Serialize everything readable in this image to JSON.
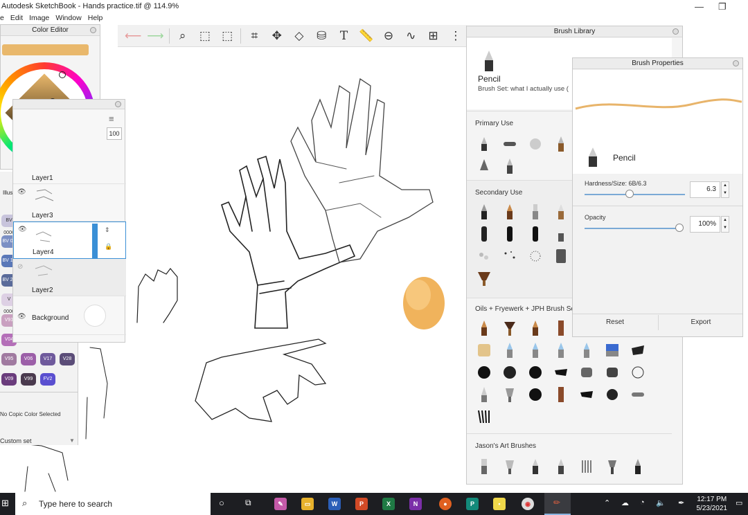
{
  "app": {
    "window_title": "Autodesk SketchBook - Hands practice.tif @ 114.9%",
    "menu": [
      "e",
      "Edit",
      "Image",
      "Window",
      "Help"
    ]
  },
  "color_editor": {
    "title": "Color Editor",
    "current_color": "#e9b86c"
  },
  "layers": {
    "opacity": "100",
    "items": [
      {
        "name": "Layer1",
        "visible": true
      },
      {
        "name": "Layer3",
        "visible": true
      },
      {
        "name": "Layer4",
        "visible": true,
        "active": true
      },
      {
        "name": "Layer2",
        "visible": false
      },
      {
        "name": "Background",
        "visible": true
      }
    ]
  },
  "copic": {
    "label_illus": "Illus",
    "chips": [
      {
        "code": "BV 0000",
        "color": "#c8c4dc"
      },
      {
        "code": "BV 01",
        "color": "#7b8fc4"
      },
      {
        "code": "BV 13",
        "color": "#5a78b8"
      },
      {
        "code": "BV 25",
        "color": "#5a6b9a"
      },
      {
        "code": "V 0000",
        "color": "#ddd0e4"
      },
      {
        "code": "V91",
        "color": "#c9a0c0"
      },
      {
        "code": "V04",
        "color": "#b46fb8"
      },
      {
        "code": "V95",
        "color": "#a07aa0"
      },
      {
        "code": "V06",
        "color": "#9c5fa8"
      },
      {
        "code": "V17",
        "color": "#6f5a9c"
      },
      {
        "code": "V28",
        "color": "#5b4d78"
      },
      {
        "code": "V09",
        "color": "#6a3c7c"
      },
      {
        "code": "V99",
        "color": "#4a3a4e"
      },
      {
        "code": "FV2",
        "color": "#5a4fd0"
      }
    ],
    "status": "No Copic Color Selected",
    "set": "Custom set"
  },
  "brush_library": {
    "title": "Brush Library",
    "current_brush": "Pencil",
    "brush_set": "Brush Set: what I actually use (",
    "sections": [
      "Primary Use",
      "Secondary Use",
      "Oils + Fryewerk + JPH Brush Set",
      "Jason's Art Brushes"
    ]
  },
  "brush_properties": {
    "title": "Brush Properties",
    "brush_name": "Pencil",
    "hardness_label": "Hardness/Size: 6B/6.3",
    "hardness_value": "6.3",
    "opacity_label": "Opacity",
    "opacity_value": "100%",
    "reset": "Reset",
    "export": "Export"
  },
  "taskbar": {
    "search_placeholder": "Type here to search",
    "time": "12:17 PM",
    "date": "5/23/2021"
  }
}
